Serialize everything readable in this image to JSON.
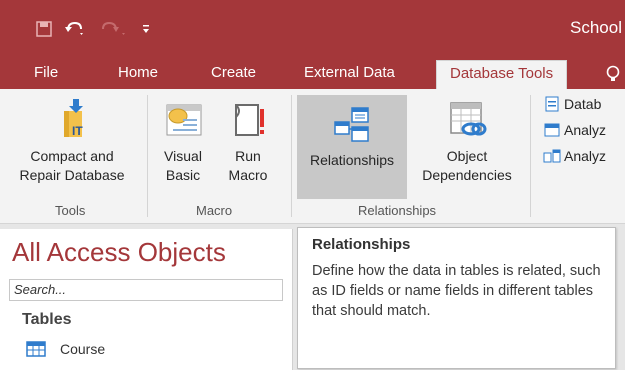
{
  "title_bar": {
    "app_title": "School",
    "save_icon": "save-icon",
    "undo_icon": "undo-icon",
    "redo_icon": "redo-icon",
    "customize_icon": "customize-qat-icon"
  },
  "tabs": [
    {
      "label": "File"
    },
    {
      "label": "Home"
    },
    {
      "label": "Create"
    },
    {
      "label": "External Data"
    },
    {
      "label": "Database Tools",
      "active": true
    }
  ],
  "ribbon": {
    "groups": {
      "tools": "Tools",
      "macro": "Macro",
      "relationships": "Relationships"
    },
    "buttons": {
      "compact_line1": "Compact and",
      "compact_line2": "Repair Database",
      "visual_line1": "Visual",
      "visual_line2": "Basic",
      "run_line1": "Run",
      "run_line2": "Macro",
      "relationships": "Relationships",
      "object_line1": "Object",
      "object_line2": "Dependencies"
    },
    "small_items": [
      "Datab",
      "Analyz",
      "Analyz"
    ]
  },
  "nav_pane": {
    "title": "All Access Objects",
    "search_placeholder": "Search...",
    "group": "Tables",
    "items": [
      "Course"
    ]
  },
  "tooltip": {
    "title": "Relationships",
    "body": "Define how the data in tables is related, such as ID fields or name fields in different tables that should match."
  },
  "colors": {
    "accent": "#a4373a",
    "ribbon_bg": "#f3f3f3"
  }
}
